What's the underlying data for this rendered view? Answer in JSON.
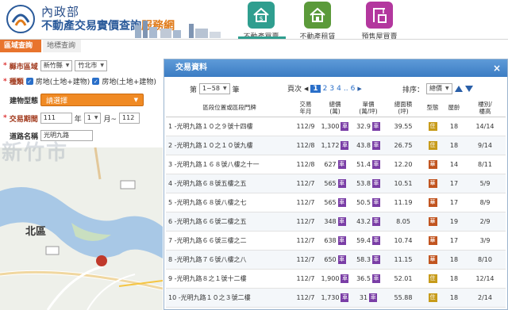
{
  "header": {
    "org": "內政部",
    "title_main": "不動產交易實價查詢",
    "title_accent": "服務網",
    "nav": [
      {
        "label": "不動產買賣",
        "icon": "house-dollar-icon",
        "color": "#2f9e8f"
      },
      {
        "label": "不動產租賃",
        "icon": "house-rent-icon",
        "color": "#5b9a3a"
      },
      {
        "label": "預售屋買賣",
        "icon": "crane-building-icon",
        "color": "#b3379e"
      }
    ]
  },
  "tabs": {
    "active": "區域查詢",
    "other": "地標查詢"
  },
  "form": {
    "county_label": "縣市區域",
    "county_value": "新竹縣",
    "district_value": "竹北市",
    "type_label": "種類",
    "type_opt1": "房地(土地+建物)",
    "type_opt2": "房地(土地+建物)",
    "building_label": "建物型態",
    "building_value": "請選擇",
    "period_label": "交易期間",
    "year_from": "111",
    "year_unit": "年",
    "month_from": "1",
    "month_unit": "月~",
    "year_to": "112",
    "road_label": "道路名稱",
    "road_value": "光明九路"
  },
  "map": {
    "watermark": "新竹市",
    "district_label": "北區"
  },
  "panel": {
    "title": "交易資料",
    "close": "×",
    "page_prefix": "第",
    "page_select": "1~58",
    "page_suffix": "筆",
    "page_label": "頁次",
    "pages": [
      "2",
      "3",
      "4",
      "..",
      "6"
    ],
    "current_page": "1",
    "sort_label": "排序：",
    "sort_value": "總價"
  },
  "table": {
    "headers": [
      "區段位置或區段門牌",
      "交易\n年月",
      "總價\n(萬)",
      "單價\n(萬/坪)",
      "總面積\n(坪)",
      "型態",
      "屋齡",
      "樓別/\n樓高"
    ],
    "rows": [
      {
        "no": "1",
        "addr": "-光明九路１０之９號十四樓",
        "date": "112/9",
        "total": "1,300",
        "unit": "32.9",
        "area": "39.55",
        "type": "住",
        "age": "18",
        "floor": "14/14"
      },
      {
        "no": "2",
        "addr": "-光明九路１０之１０號九樓",
        "date": "112/8",
        "total": "1,172",
        "unit": "43.8",
        "area": "26.75",
        "type": "住",
        "age": "18",
        "floor": "9/14"
      },
      {
        "no": "3",
        "addr": "-光明九路１６８號八樓之十一",
        "date": "112/8",
        "total": "627",
        "unit": "51.4",
        "area": "12.20",
        "type": "華",
        "age": "14",
        "floor": "8/11"
      },
      {
        "no": "4",
        "addr": "-光明九路６８號五樓之五",
        "date": "112/7",
        "total": "565",
        "unit": "53.8",
        "area": "10.51",
        "type": "華",
        "age": "17",
        "floor": "5/9"
      },
      {
        "no": "5",
        "addr": "-光明九路６８號八樓之七",
        "date": "112/7",
        "total": "565",
        "unit": "50.5",
        "area": "11.19",
        "type": "華",
        "age": "17",
        "floor": "8/9"
      },
      {
        "no": "6",
        "addr": "-光明九路６６號二樓之五",
        "date": "112/7",
        "total": "348",
        "unit": "43.2",
        "area": "8.05",
        "type": "華",
        "age": "19",
        "floor": "2/9"
      },
      {
        "no": "7",
        "addr": "-光明九路６６號三樓之二",
        "date": "112/7",
        "total": "638",
        "unit": "59.4",
        "area": "10.74",
        "type": "華",
        "age": "17",
        "floor": "3/9"
      },
      {
        "no": "8",
        "addr": "-光明九路７６號八樓之八",
        "date": "112/7",
        "total": "650",
        "unit": "58.3",
        "area": "11.15",
        "type": "華",
        "age": "18",
        "floor": "8/10"
      },
      {
        "no": "9",
        "addr": "-光明九路８之１號十二樓",
        "date": "112/7",
        "total": "1,900",
        "unit": "36.5",
        "area": "52.01",
        "type": "住",
        "age": "18",
        "floor": "12/14"
      },
      {
        "no": "10",
        "addr": "-光明九路１０之３號二樓",
        "date": "112/7",
        "total": "1,730",
        "unit": "31",
        "area": "55.88",
        "type": "住",
        "age": "18",
        "floor": "2/14"
      }
    ],
    "park_tag": "車",
    "type_colors": {
      "住": "#c79b1a",
      "華": "#c1541f"
    }
  }
}
